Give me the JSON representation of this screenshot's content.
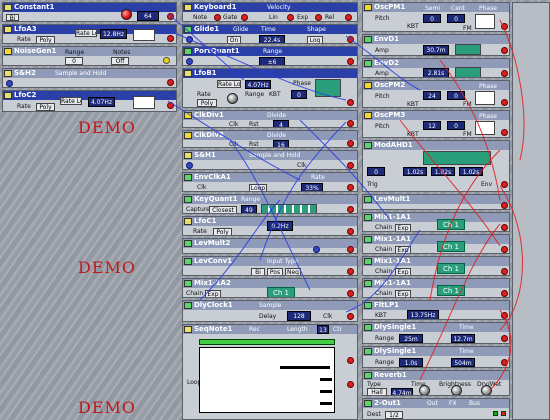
{
  "demo_label": "DEMO",
  "modules": {
    "constant1": {
      "title": "Constant1",
      "value": "64",
      "btn": "Bi"
    },
    "lfo_a": {
      "title": "LfoA3",
      "rate": "Rate",
      "poly": "Poly",
      "rate_lo": "Rate Lo",
      "freq": "12.8Hz"
    },
    "noise_gen": {
      "title": "NoiseGen1",
      "range": "Range",
      "notes": "Notes",
      "range_val": "0",
      "notes_val": "Off"
    },
    "sh2": {
      "title": "S&H2",
      "desc": "Sample and Hold"
    },
    "lfo_c2": {
      "title": "LfoC2",
      "rate": "Rate",
      "poly": "Poly",
      "rate_lo": "Rate Lo",
      "freq": "4.07Hz"
    },
    "keyboard1": {
      "title": "Keyboard1",
      "velocity": "Velocity",
      "note": "Note",
      "gate": "Gate",
      "lin": "Lin",
      "exp": "Exp",
      "rel": "Rel"
    },
    "glide1": {
      "title": "Glide1",
      "glide": "Glide",
      "on": "On",
      "time": "Time",
      "time_val": "22.4s",
      "shape": "Shape",
      "log": "Log"
    },
    "port_quant1": {
      "title": "PortQuant1",
      "range": "Range",
      "range_val": "±6"
    },
    "lfo_b1": {
      "title": "LfoB1",
      "rate_lo": "Rate Lo",
      "freq": "4.07Hz",
      "phase": "Phase",
      "rate": "Rate",
      "range": "Range",
      "kbt": "KBT",
      "phase_val": "0",
      "poly": "Poly"
    },
    "clk_div1": {
      "title": "ClkDiv1",
      "divide": "Divide",
      "div_val": "4",
      "clk": "Clk",
      "rst": "Rst"
    },
    "clk_div2": {
      "title": "ClkDiv2",
      "divide": "Divide",
      "div_val": "16",
      "clk": "Clk",
      "rst": "Rst"
    },
    "sh1": {
      "title": "S&H1",
      "desc": "Sample and Hold",
      "clk": "Clk"
    },
    "env_clk": {
      "title": "EnvClkA1",
      "rate": "Rate",
      "val": "33%",
      "clk": "Clk",
      "loop": "Loop"
    },
    "key_quant": {
      "title": "KeyQuant1",
      "range": "Range",
      "capture": "Capture",
      "closest": "Closest",
      "range_val": "49"
    },
    "lfo_c1": {
      "title": "LfoC1",
      "rate": "Rate",
      "poly": "Poly",
      "freq": "0.2Hz"
    },
    "lev_mult2": {
      "title": "LevMult2"
    },
    "lev_conv1": {
      "title": "LevConv1",
      "input_type": "Input Type",
      "bi": "Bi",
      "pos": "Pos",
      "neg": "Neg"
    },
    "mix1_a2": {
      "title": "Mix1-1A2",
      "chain": "Chain",
      "exp": "Exp",
      "ch1": "Ch 1"
    },
    "dly_clock1": {
      "title": "DlyClock1",
      "sample": "Sample",
      "delay": "Delay",
      "val": "128",
      "clk": "Clk"
    },
    "seq_note1": {
      "title": "SeqNote1",
      "rec": "Rec",
      "length": "Length",
      "length_val": "13",
      "ctr": "Ctr",
      "loop": "Loop"
    },
    "osc_pm1": {
      "title": "OscPM1",
      "pitch": "Pitch",
      "semi": "Semi",
      "cent": "Cent",
      "fm": "FM",
      "kbt": "KBT",
      "cent_val": "0",
      "fm_val": "0",
      "phase": "Phase",
      "mod": "Mod",
      "sync": "Sync"
    },
    "env_d1": {
      "title": "EnvD1",
      "reset": "Reset",
      "val": "30.7m",
      "inv": "Inv",
      "amp": "Amp"
    },
    "env_d2": {
      "title": "EnvD2",
      "amp": "Amp",
      "val": "2.81s"
    },
    "osc_pm2": {
      "title": "OscPM2",
      "pitch": "Pitch",
      "semi": "24",
      "cent": "0",
      "kbt": "KBT",
      "fm": "FM",
      "phase": "Phase"
    },
    "osc_pm3": {
      "title": "OscPM3",
      "pitch": "Pitch",
      "semi": "12",
      "cent": "0",
      "kbt": "KBT",
      "fm": "FM",
      "phase": "Phase"
    },
    "mod_ahd1": {
      "title": "ModAHD1",
      "a": "1.02s",
      "h": "1.02s",
      "d": "1.02s",
      "a_val": "0",
      "trig": "Trig",
      "env": "Env"
    },
    "lev_mult1": {
      "title": "LevMult1"
    },
    "mix1_a1a": {
      "title": "Mix1-1A1",
      "chain": "Chain",
      "exp": "Exp",
      "ch1": "Ch 1"
    },
    "mix1_a1b": {
      "title": "Mix1-1A1",
      "chain": "Chain",
      "exp": "Exp",
      "ch1": "Ch 1"
    },
    "mix1_a1c": {
      "title": "Mix1-1A1",
      "chain": "Chain",
      "exp": "Exp",
      "ch1": "Ch 1"
    },
    "mix1_a1d": {
      "title": "Mix1-1A1",
      "chain": "Chain",
      "exp": "Exp",
      "ch1": "Ch 1"
    },
    "flt_lp1": {
      "title": "FltLP1",
      "freq": "13.75Hz",
      "kbt": "KBT"
    },
    "dly_single1": {
      "title": "DlySingle1",
      "time": "Time",
      "range": "Range",
      "range_val": "25m",
      "time_val": "12.7m"
    },
    "dly_single2": {
      "title": "DlySingle1",
      "time": "Time",
      "range": "Range",
      "range_val": "1.0s",
      "time_val": "504m"
    },
    "reverb1": {
      "title": "Reverb1",
      "type": "Type",
      "time": "Time",
      "brightness": "Brightness",
      "dry_wet": "Dry/Wet",
      "type_val": "Hall",
      "time_val": "4.74m"
    },
    "out1": {
      "title": "2-Out1",
      "dest": "Dest",
      "out": "Out",
      "fx": "FX",
      "bus": "Bus",
      "dest_val": "1/2"
    }
  },
  "colors": {
    "title_bar": "#2a3fa8",
    "wire_blue": "#2a3fe0",
    "wire_red": "#e02020",
    "demo_red": "#c21818"
  }
}
